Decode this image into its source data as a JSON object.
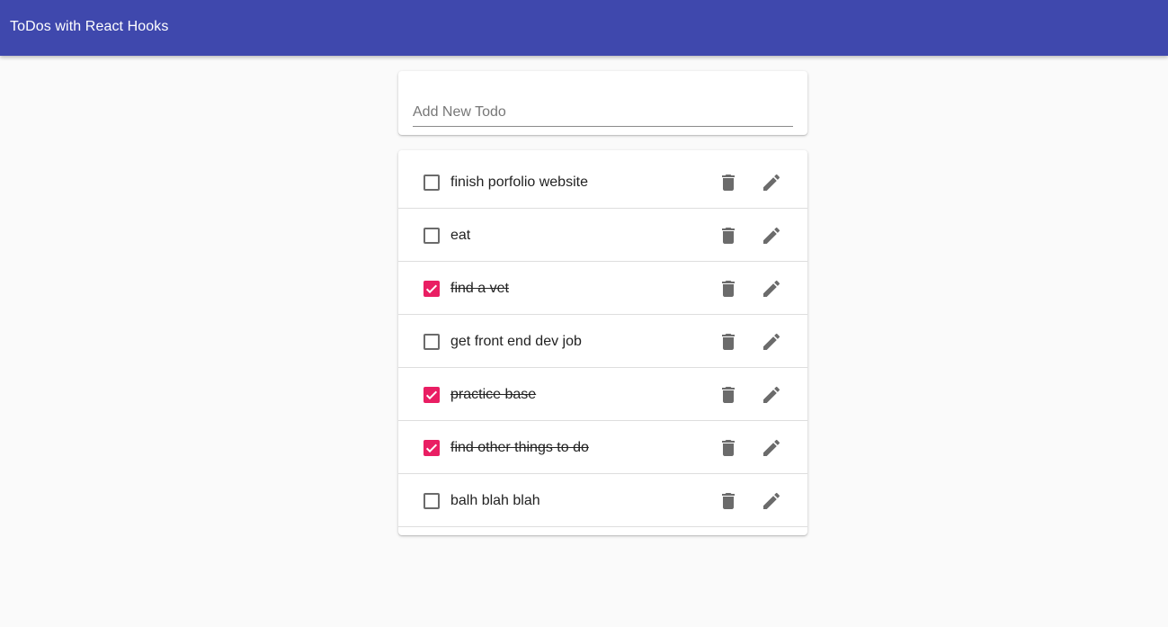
{
  "appbar": {
    "title": "ToDos with React Hooks",
    "color": "#3f48ad"
  },
  "form": {
    "placeholder": "Add New Todo",
    "value": ""
  },
  "icons": {
    "delete": "trash-icon",
    "edit": "pencil-icon",
    "checked": "check-icon"
  },
  "accent": "#e91e63",
  "todos": [
    {
      "task": "finish porfolio website",
      "completed": false
    },
    {
      "task": "eat",
      "completed": false
    },
    {
      "task": "find a vet",
      "completed": true
    },
    {
      "task": "get front end dev job",
      "completed": false
    },
    {
      "task": "practice base",
      "completed": true
    },
    {
      "task": "find other things to do",
      "completed": true
    },
    {
      "task": "balh blah blah",
      "completed": false
    }
  ]
}
